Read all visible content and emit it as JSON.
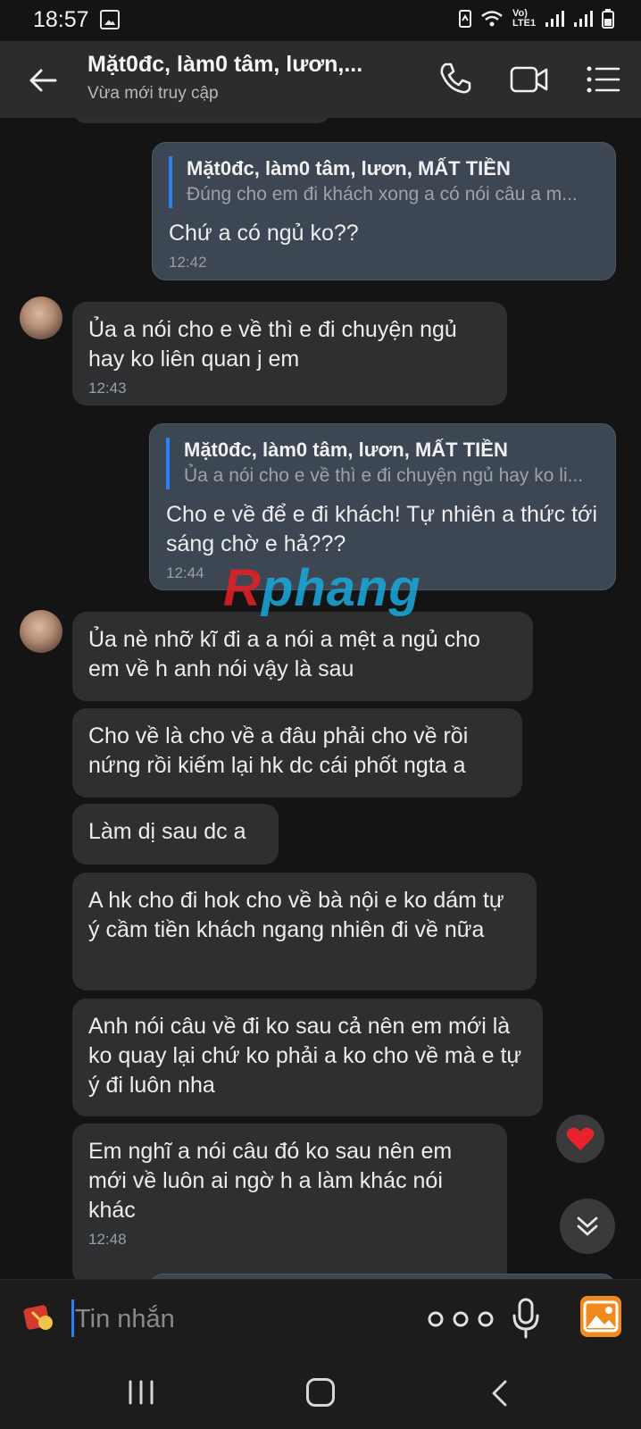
{
  "status_bar": {
    "time": "18:57",
    "network_label": "Vo) LTE1"
  },
  "header": {
    "title": "Mặt0đc, làm0 tâm, lươn,...",
    "subtitle": "Vừa mới truy cập"
  },
  "messages": [
    {
      "direction": "out",
      "quote_name": "Mặt0đc, làm0 tâm, lươn, MẤT TIỀN",
      "quote_text": "Đúng cho em đi khách xong a có nói câu a m...",
      "text": "Chứ a có ngủ ko??",
      "time": "12:42"
    },
    {
      "direction": "in",
      "text": "Ủa a nói cho e về thì e đi chuyện ngủ hay ko liên quan j em",
      "time": "12:43"
    },
    {
      "direction": "out",
      "quote_name": "Mặt0đc, làm0 tâm, lươn, MẤT TIỀN",
      "quote_text": "Ủa a nói cho e về thì e đi chuyện ngủ hay ko li...",
      "text": "Cho e về để e đi khách! Tự nhiên a thức tới sáng chờ e hả???",
      "time": "12:44"
    },
    {
      "direction": "in",
      "text": "Ủa nè nhỡ kĩ đi a a nói a mệt a ngủ cho em về h anh nói vậy là sau"
    },
    {
      "direction": "in",
      "text": "Cho về là cho về a đâu phải cho về rồi nứng rồi kiếm lại hk dc cái phốt ngta a"
    },
    {
      "direction": "in",
      "text": "Làm dị sau dc a"
    },
    {
      "direction": "in",
      "text": "A hk cho đi hok cho về bà nội e ko dám tự ý cầm tiền khách ngang nhiên đi về nữa"
    },
    {
      "direction": "in",
      "text": "Anh nói câu về đi ko sau cả nên em mới là ko quay lại chứ ko phải a ko cho về mà e tự ý đi luôn nha"
    },
    {
      "direction": "in",
      "text": "Em nghĩ a nói câu đó ko sau nên em mới về luôn ai ngờ h a  làm khác nói khác",
      "time": "12:48"
    }
  ],
  "watermark": {
    "part1": "R",
    "part2": "phang"
  },
  "composer": {
    "placeholder": "Tin nhắn"
  },
  "colors": {
    "accent": "#2d7ff2",
    "outgoing_bubble": "#3d4653",
    "incoming_bubble": "#2e2f31",
    "gallery": "#f08a1c",
    "heart": "#e8232c"
  },
  "icons": [
    "back-arrow-icon",
    "phone-icon",
    "video-call-icon",
    "list-menu-icon",
    "heart-icon",
    "double-chevron-down-icon",
    "sticker-icon",
    "more-dots-icon",
    "microphone-icon",
    "image-gallery-icon",
    "recent-apps-icon",
    "home-icon",
    "nav-back-icon"
  ]
}
